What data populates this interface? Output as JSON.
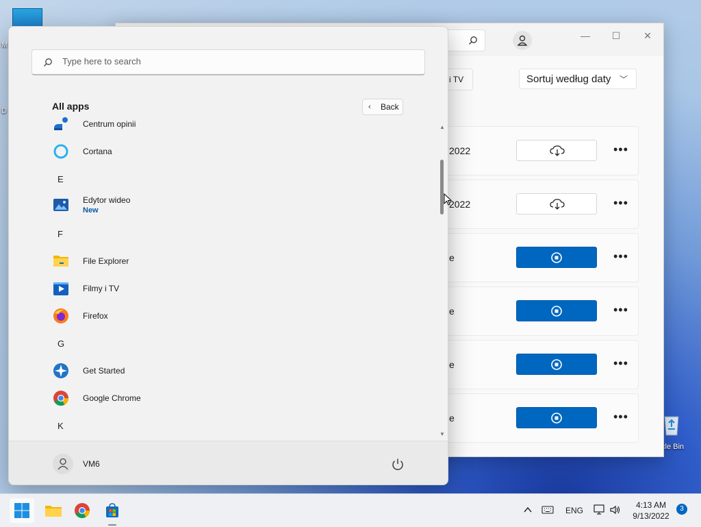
{
  "desktop": {
    "icon_labels": [
      "M",
      "D"
    ],
    "recycle_bin_label": "cle Bin"
  },
  "store": {
    "window_buttons": {
      "minimize": "—",
      "maximize": "☐",
      "close": "✕"
    },
    "filter_chip": "i TV",
    "sort_label": "Sortuj według daty",
    "rows": [
      {
        "text": "2022",
        "action": "download"
      },
      {
        "text": "2022",
        "action": "download"
      },
      {
        "text": "e",
        "action": "stop"
      },
      {
        "text": "e",
        "action": "stop"
      },
      {
        "text": "e",
        "action": "stop"
      },
      {
        "text": "e",
        "action": "stop"
      }
    ]
  },
  "start_menu": {
    "search_placeholder": "Type here to search",
    "all_apps_title": "All apps",
    "back_label": "Back",
    "items": [
      {
        "kind": "app",
        "name": "Centrum opinii",
        "icon": "feedback-hub-icon"
      },
      {
        "kind": "app",
        "name": "Cortana",
        "icon": "cortana-icon"
      },
      {
        "kind": "letter",
        "name": "E"
      },
      {
        "kind": "app",
        "name": "Edytor wideo",
        "sub": "New",
        "icon": "video-editor-icon"
      },
      {
        "kind": "letter",
        "name": "F"
      },
      {
        "kind": "app",
        "name": "File Explorer",
        "icon": "folder-icon"
      },
      {
        "kind": "app",
        "name": "Filmy i TV",
        "icon": "movies-tv-icon"
      },
      {
        "kind": "app",
        "name": "Firefox",
        "icon": "firefox-icon"
      },
      {
        "kind": "letter",
        "name": "G"
      },
      {
        "kind": "app",
        "name": "Get Started",
        "icon": "get-started-icon"
      },
      {
        "kind": "app",
        "name": "Google Chrome",
        "icon": "chrome-icon"
      },
      {
        "kind": "letter",
        "name": "K"
      }
    ],
    "user_name": "VM6"
  },
  "taskbar": {
    "apps": [
      "start-icon",
      "file-explorer-icon",
      "chrome-icon",
      "store-icon"
    ],
    "language": "ENG",
    "time": "4:13 AM",
    "date": "9/13/2022",
    "notification_count": "3"
  },
  "colors": {
    "accent": "#0067c0"
  }
}
